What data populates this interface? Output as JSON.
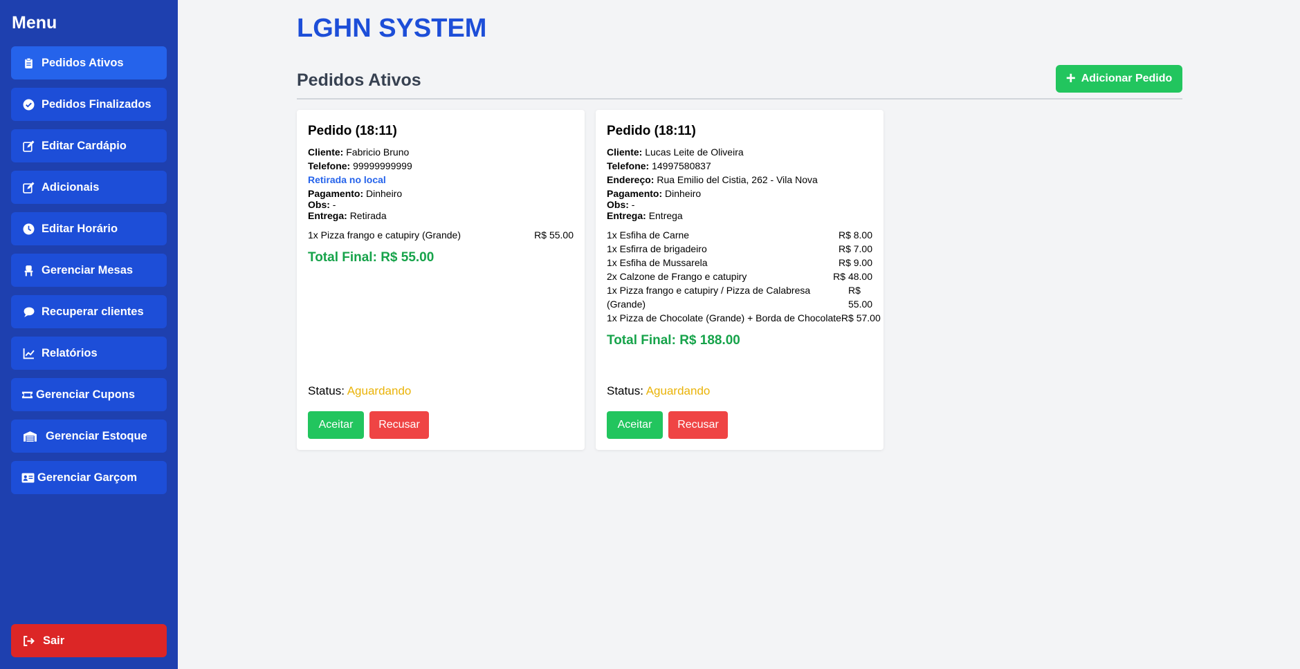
{
  "sidebar": {
    "title": "Menu",
    "items": [
      {
        "label": "Pedidos Ativos",
        "icon": "clipboard-icon",
        "active": true
      },
      {
        "label": "Pedidos Finalizados",
        "icon": "check-circle-icon"
      },
      {
        "label": "Editar Cardápio",
        "icon": "edit-icon"
      },
      {
        "label": "Adicionais",
        "icon": "edit-icon"
      },
      {
        "label": "Editar Horário",
        "icon": "clock-icon"
      },
      {
        "label": "Gerenciar Mesas",
        "icon": "chair-icon"
      },
      {
        "label": "Recuperar clientes",
        "icon": "chat-bubble-icon"
      },
      {
        "label": "Relatórios",
        "icon": "line-chart-icon"
      },
      {
        "label": "Gerenciar Cupons",
        "icon": "ticket-icon"
      },
      {
        "label": "Gerenciar Estoque",
        "icon": "warehouse-icon"
      },
      {
        "label": "Gerenciar Garçom",
        "icon": "id-card-icon"
      }
    ],
    "logout": {
      "label": "Sair",
      "icon": "sign-out-icon"
    }
  },
  "header": {
    "app_title": "LGHN SYSTEM",
    "section_title": "Pedidos Ativos",
    "add_button": "Adicionar Pedido"
  },
  "orders": [
    {
      "title": "Pedido (18:11)",
      "cliente_label": "Cliente:",
      "cliente": "Fabricio Bruno",
      "telefone_label": "Telefone:",
      "telefone": "99999999999",
      "pickup_text": "Retirada no local",
      "pagamento_label": "Pagamento:",
      "pagamento": "Dinheiro",
      "obs_label": "Obs:",
      "obs": "-",
      "entrega_label": "Entrega:",
      "entrega": "Retirada",
      "items": [
        {
          "name": "1x Pizza frango e catupiry (Grande)",
          "price": "R$ 55.00"
        }
      ],
      "total": "Total Final: R$ 55.00",
      "status_label": "Status:",
      "status": "Aguardando",
      "accept": "Aceitar",
      "reject": "Recusar"
    },
    {
      "title": "Pedido (18:11)",
      "cliente_label": "Cliente:",
      "cliente": "Lucas Leite de Oliveira",
      "telefone_label": "Telefone:",
      "telefone": "14997580837",
      "endereco_label": "Endereço:",
      "endereco": "Rua Emilio del Cistia, 262 - Vila Nova",
      "pagamento_label": "Pagamento:",
      "pagamento": "Dinheiro",
      "obs_label": "Obs:",
      "obs": "-",
      "entrega_label": "Entrega:",
      "entrega": "Entrega",
      "items": [
        {
          "name": "1x Esfiha de Carne",
          "price": "R$ 8.00"
        },
        {
          "name": "1x Esfirra de brigadeiro",
          "price": "R$ 7.00"
        },
        {
          "name": "1x Esfiha de Mussarela",
          "price": "R$ 9.00"
        },
        {
          "name": "2x Calzone de Frango e catupiry",
          "price": "R$ 48.00"
        },
        {
          "name": "1x Pizza frango e catupiry / Pizza de Calabresa (Grande)",
          "price": "R$ 55.00"
        },
        {
          "name": "1x Pizza de Chocolate (Grande) + Borda de Chocolate",
          "price": "R$ 57.00"
        }
      ],
      "total": "Total Final: R$ 188.00",
      "status_label": "Status:",
      "status": "Aguardando",
      "accept": "Aceitar",
      "reject": "Recusar"
    }
  ]
}
